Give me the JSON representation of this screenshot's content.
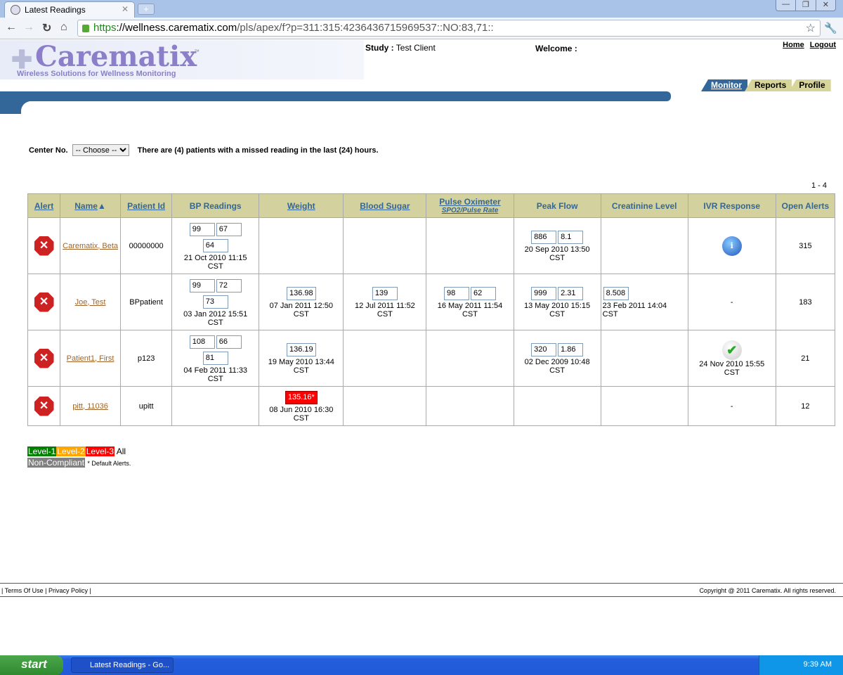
{
  "browser": {
    "tab_title": "Latest Readings",
    "url_scheme": "https",
    "url_domain": "://wellness.carematix.com",
    "url_path": "/pls/apex/f?p=311:315:4236436715969537::NO:83,71::"
  },
  "header": {
    "logo": "Carematix",
    "tagline": "Wireless Solutions for Wellness Monitoring",
    "study_label": "Study :",
    "study_value": "Test Client",
    "welcome_label": "Welcome :",
    "home": "Home",
    "logout": "Logout"
  },
  "tabs": [
    "Monitor",
    "Reports",
    "Profile"
  ],
  "filter": {
    "label": "Center No.",
    "select_value": "-- Choose --",
    "message": "There are (4) patients with a missed reading in the last (24) hours."
  },
  "pager": "1 - 4",
  "columns": [
    "Alert",
    "Name",
    "Patient Id",
    "BP Readings",
    "Weight",
    "Blood Sugar",
    "Pulse Oximeter",
    "Peak Flow",
    "Creatinine Level",
    "IVR Response",
    "Open Alerts"
  ],
  "column_sub": "SPO2/Pulse Rate",
  "sort_indicator": "▲",
  "rows": [
    {
      "name": "Carematix, Beta",
      "patient_id": "00000000",
      "bp": {
        "values": [
          "99",
          "67",
          "64"
        ],
        "date": "21 Oct 2010 11:15",
        "tz": "CST"
      },
      "weight": null,
      "sugar": null,
      "pulse": null,
      "peak": {
        "values": [
          "886",
          "8.1"
        ],
        "date": "20 Sep 2010 13:50",
        "tz": "CST"
      },
      "creatinine": null,
      "ivr": {
        "icon": "info"
      },
      "open_alerts": "315"
    },
    {
      "name": "Joe, Test",
      "patient_id": "BPpatient",
      "bp": {
        "values": [
          "99",
          "72",
          "73"
        ],
        "date": "03 Jan 2012 15:51",
        "tz": "CST"
      },
      "weight": {
        "values": [
          "136.98"
        ],
        "date": "07 Jan 2011 12:50",
        "tz": "CST"
      },
      "sugar": {
        "values": [
          "139"
        ],
        "date": "12 Jul 2011 11:52",
        "tz": "CST"
      },
      "pulse": {
        "values": [
          "98",
          "62"
        ],
        "date": "16 May 2011 11:54",
        "tz": "CST"
      },
      "peak": {
        "values": [
          "999",
          "2.31"
        ],
        "date": "13 May 2010 15:15",
        "tz": "CST"
      },
      "creatinine": {
        "values": [
          "8.508"
        ],
        "date": "23 Feb 2011 14:04",
        "tz": "CST"
      },
      "ivr": {
        "text": "-"
      },
      "open_alerts": "183"
    },
    {
      "name": "Patient1, First",
      "patient_id": "p123",
      "bp": {
        "values": [
          "108",
          "66",
          "81"
        ],
        "date": "04 Feb 2011 11:33",
        "tz": "CST"
      },
      "weight": {
        "values": [
          "136.19"
        ],
        "date": "19 May 2010 13:44",
        "tz": "CST"
      },
      "sugar": null,
      "pulse": null,
      "peak": {
        "values": [
          "320",
          "1.86"
        ],
        "date": "02 Dec 2009 10:48",
        "tz": "CST"
      },
      "creatinine": null,
      "ivr": {
        "icon": "check",
        "date": "24 Nov 2010 15:55",
        "tz": "CST"
      },
      "open_alerts": "21"
    },
    {
      "name": "pitt, 11036",
      "patient_id": "upitt",
      "bp": null,
      "weight": {
        "values": [
          "135.16*"
        ],
        "alert": true,
        "date": "08 Jun 2010 16:30",
        "tz": "CST"
      },
      "sugar": null,
      "pulse": null,
      "peak": null,
      "creatinine": null,
      "ivr": {
        "text": "-"
      },
      "open_alerts": "12"
    }
  ],
  "legend": {
    "level1": "Level-1",
    "level2": "Level-2",
    "level3": "Level-3",
    "all": "All",
    "noncompliant": "Non-Compliant",
    "note": "* Default Alerts.",
    "colors": {
      "level1": "#008000",
      "level2": "#ffa500",
      "level3": "#ff0000",
      "noncompliant": "#808080"
    }
  },
  "footer": {
    "left": "| Terms Of Use | Privacy Policy |",
    "right": "Copyright @ 2011 Carematix. All rights reserved."
  },
  "taskbar": {
    "start": "start",
    "task": "Latest Readings - Go...",
    "time": "9:39 AM"
  }
}
